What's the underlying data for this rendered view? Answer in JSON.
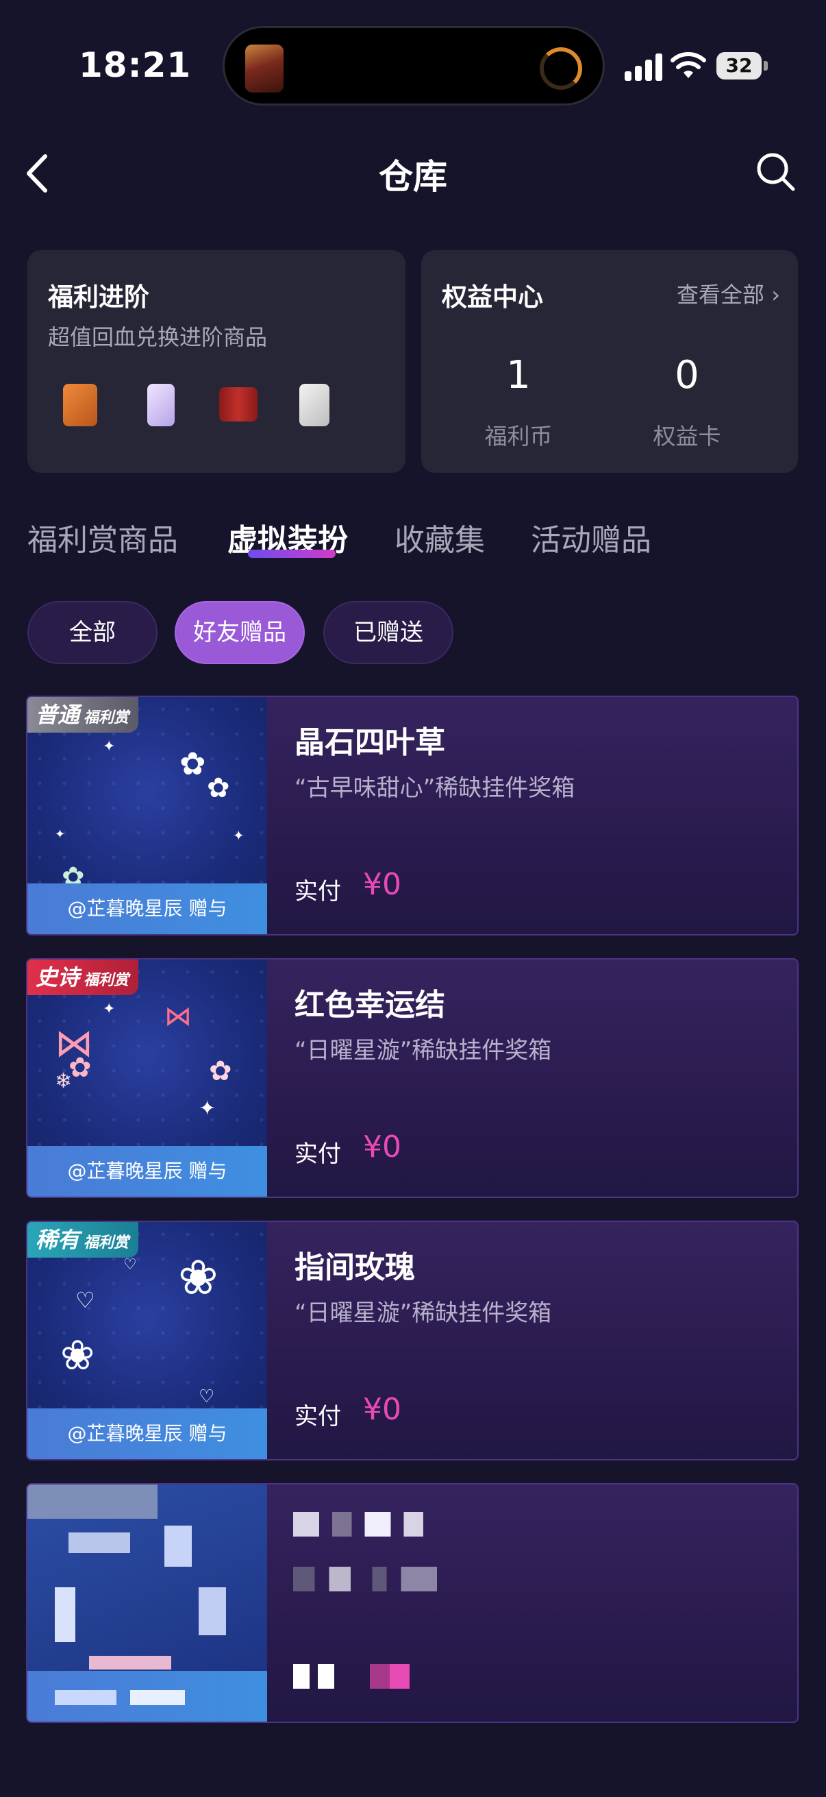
{
  "status_bar": {
    "time": "18:21",
    "battery": "32"
  },
  "nav": {
    "title": "仓库"
  },
  "welfare_card": {
    "title": "福利进阶",
    "subtitle": "超值回血兑换进阶商品"
  },
  "rights_card": {
    "title": "权益中心",
    "see_all": "查看全部",
    "stats": [
      {
        "value": "1",
        "label": "福利币"
      },
      {
        "value": "0",
        "label": "权益卡"
      }
    ]
  },
  "tabs": [
    "福利赏商品",
    "虚拟装扮",
    "收藏集",
    "活动赠品"
  ],
  "filters": [
    "全部",
    "好友赠品",
    "已赠送"
  ],
  "items": [
    {
      "rarity": "普通",
      "rarity_tag": "福利赏",
      "title": "晶石四叶草",
      "subtitle": "“古早味甜心”稀缺挂件奖箱",
      "gifter": "@芷暮晚星辰 赠与",
      "pay_label": "实付",
      "price": "¥0"
    },
    {
      "rarity": "史诗",
      "rarity_tag": "福利赏",
      "title": "红色幸运结",
      "subtitle": "“日曜星漩”稀缺挂件奖箱",
      "gifter": "@芷暮晚星辰 赠与",
      "pay_label": "实付",
      "price": "¥0"
    },
    {
      "rarity": "稀有",
      "rarity_tag": "福利赏",
      "title": "指间玫瑰",
      "subtitle": "“日曜星漩”稀缺挂件奖箱",
      "gifter": "@芷暮晚星辰 赠与",
      "pay_label": "实付",
      "price": "¥0"
    }
  ],
  "colors": {
    "accent": "#9a5ad8",
    "price": "#e94bb5",
    "background": "#15142a"
  }
}
